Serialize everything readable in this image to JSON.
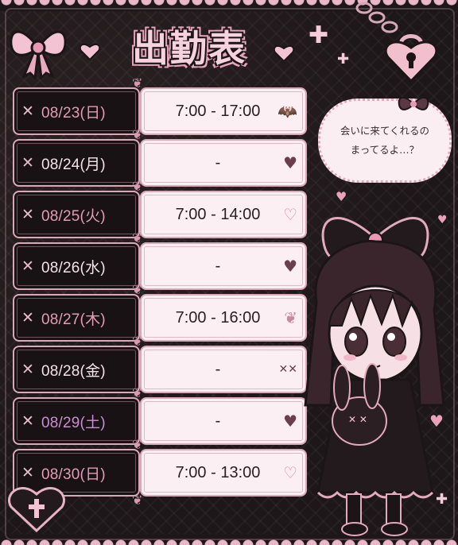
{
  "title": "出勤表",
  "speech": {
    "line1": "会いに来てくれるの",
    "line2": "まってるよ…？"
  },
  "schedule": [
    {
      "date": "08/23(日)",
      "time": "7:00 - 17:00",
      "highlight": true,
      "deco": "bat-icon"
    },
    {
      "date": "08/24(月)",
      "time": "-",
      "highlight": false,
      "deco": "heart-icon"
    },
    {
      "date": "08/25(火)",
      "time": "7:00 - 14:00",
      "highlight": true,
      "deco": "hearts-icon"
    },
    {
      "date": "08/26(水)",
      "time": "-",
      "highlight": false,
      "deco": "heart-cross-icon"
    },
    {
      "date": "08/27(木)",
      "time": "7:00 - 16:00",
      "highlight": true,
      "deco": "bow-icon"
    },
    {
      "date": "08/28(金)",
      "time": "-",
      "highlight": false,
      "deco": "stars-icon"
    },
    {
      "date": "08/29(土)",
      "time": "-",
      "highlight": true,
      "deco": "heart-icon"
    },
    {
      "date": "08/30(日)",
      "time": "7:00 - 13:00",
      "highlight": true,
      "deco": "hearts-icon"
    }
  ],
  "colors": {
    "accent": "#e39cb5",
    "dark": "#1e1719",
    "light": "#fbeff3"
  }
}
